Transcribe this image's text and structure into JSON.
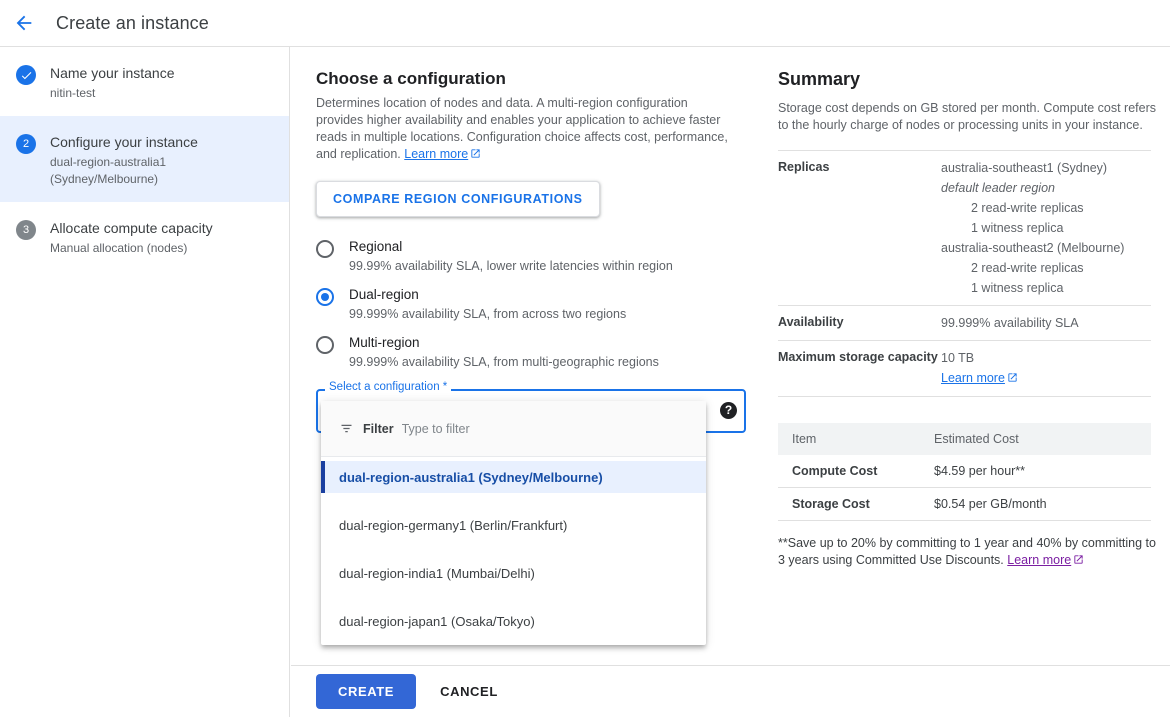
{
  "header": {
    "title": "Create an instance",
    "back_icon": "arrow-back-icon"
  },
  "sidebar": {
    "steps": [
      {
        "marker": "check-icon",
        "state": "done",
        "title": "Name your instance",
        "subtitle": "nitin-test"
      },
      {
        "marker": "2",
        "state": "current",
        "title": "Configure your instance",
        "subtitle": "dual-region-australia1 (Sydney/Melbourne)"
      },
      {
        "marker": "3",
        "state": "todo",
        "title": "Allocate compute capacity",
        "subtitle": "Manual allocation (nodes)"
      }
    ]
  },
  "center": {
    "heading": "Choose a configuration",
    "description": "Determines location of nodes and data. A multi-region configuration provides higher availability and enables your application to achieve faster reads in multiple locations. Configuration choice affects cost, performance, and replication.",
    "description_link": "Learn more",
    "compare_button": "COMPARE REGION CONFIGURATIONS",
    "radio_options": [
      {
        "label": "Regional",
        "desc": "99.99% availability SLA, lower write latencies within region",
        "selected": false
      },
      {
        "label": "Dual-region",
        "desc": "99.999% availability SLA, from across two regions",
        "selected": true
      },
      {
        "label": "Multi-region",
        "desc": "99.999% availability SLA, from multi-geographic regions",
        "selected": false
      }
    ],
    "select": {
      "label": "Select a configuration *",
      "value": "",
      "help_icon": "help-icon"
    },
    "dropdown": {
      "filter_icon": "filter-icon",
      "filter_label": "Filter",
      "filter_value": "",
      "filter_placeholder": "Type to filter",
      "options": [
        {
          "label": "dual-region-australia1 (Sydney/Melbourne)",
          "selected": true
        },
        {
          "label": "dual-region-germany1 (Berlin/Frankfurt)",
          "selected": false
        },
        {
          "label": "dual-region-india1 (Mumbai/Delhi)",
          "selected": false
        },
        {
          "label": "dual-region-japan1 (Osaka/Tokyo)",
          "selected": false
        }
      ]
    }
  },
  "summary": {
    "title": "Summary",
    "description": "Storage cost depends on GB stored per month. Compute cost refers to the hourly charge of nodes or processing units in your instance.",
    "rows": [
      {
        "key": "Replicas",
        "lines": [
          {
            "text": "australia-southeast1 (Sydney)",
            "style": "normal"
          },
          {
            "text": "default leader region",
            "style": "italic"
          },
          {
            "text": "2 read-write replicas",
            "style": "indent"
          },
          {
            "text": "1 witness replica",
            "style": "indent"
          },
          {
            "text": "australia-southeast2 (Melbourne)",
            "style": "normal"
          },
          {
            "text": "2 read-write replicas",
            "style": "indent"
          },
          {
            "text": "1 witness replica",
            "style": "indent"
          }
        ]
      },
      {
        "key": "Availability",
        "lines": [
          {
            "text": "99.999% availability SLA",
            "style": "normal"
          }
        ]
      },
      {
        "key": "Maximum storage capacity",
        "lines": [
          {
            "text": "10 TB",
            "style": "normal"
          }
        ],
        "link": "Learn more"
      }
    ],
    "cost_table": {
      "headers": [
        "Item",
        "Estimated Cost"
      ],
      "rows": [
        {
          "item": "Compute Cost",
          "cost": "$4.59 per hour**"
        },
        {
          "item": "Storage Cost",
          "cost": "$0.54 per GB/month"
        }
      ]
    },
    "footnote": "**Save up to 20% by committing to 1 year and 40% by committing to 3 years using Committed Use Discounts.",
    "footnote_link": "Learn more"
  },
  "actions": {
    "create": "CREATE",
    "cancel": "CANCEL"
  },
  "colors": {
    "accent": "#1a73e8",
    "create_button": "#3367d6",
    "active_step_bg": "#e8f0fe",
    "visited_link": "#7b1fa2",
    "todo_marker": "#80868b"
  }
}
